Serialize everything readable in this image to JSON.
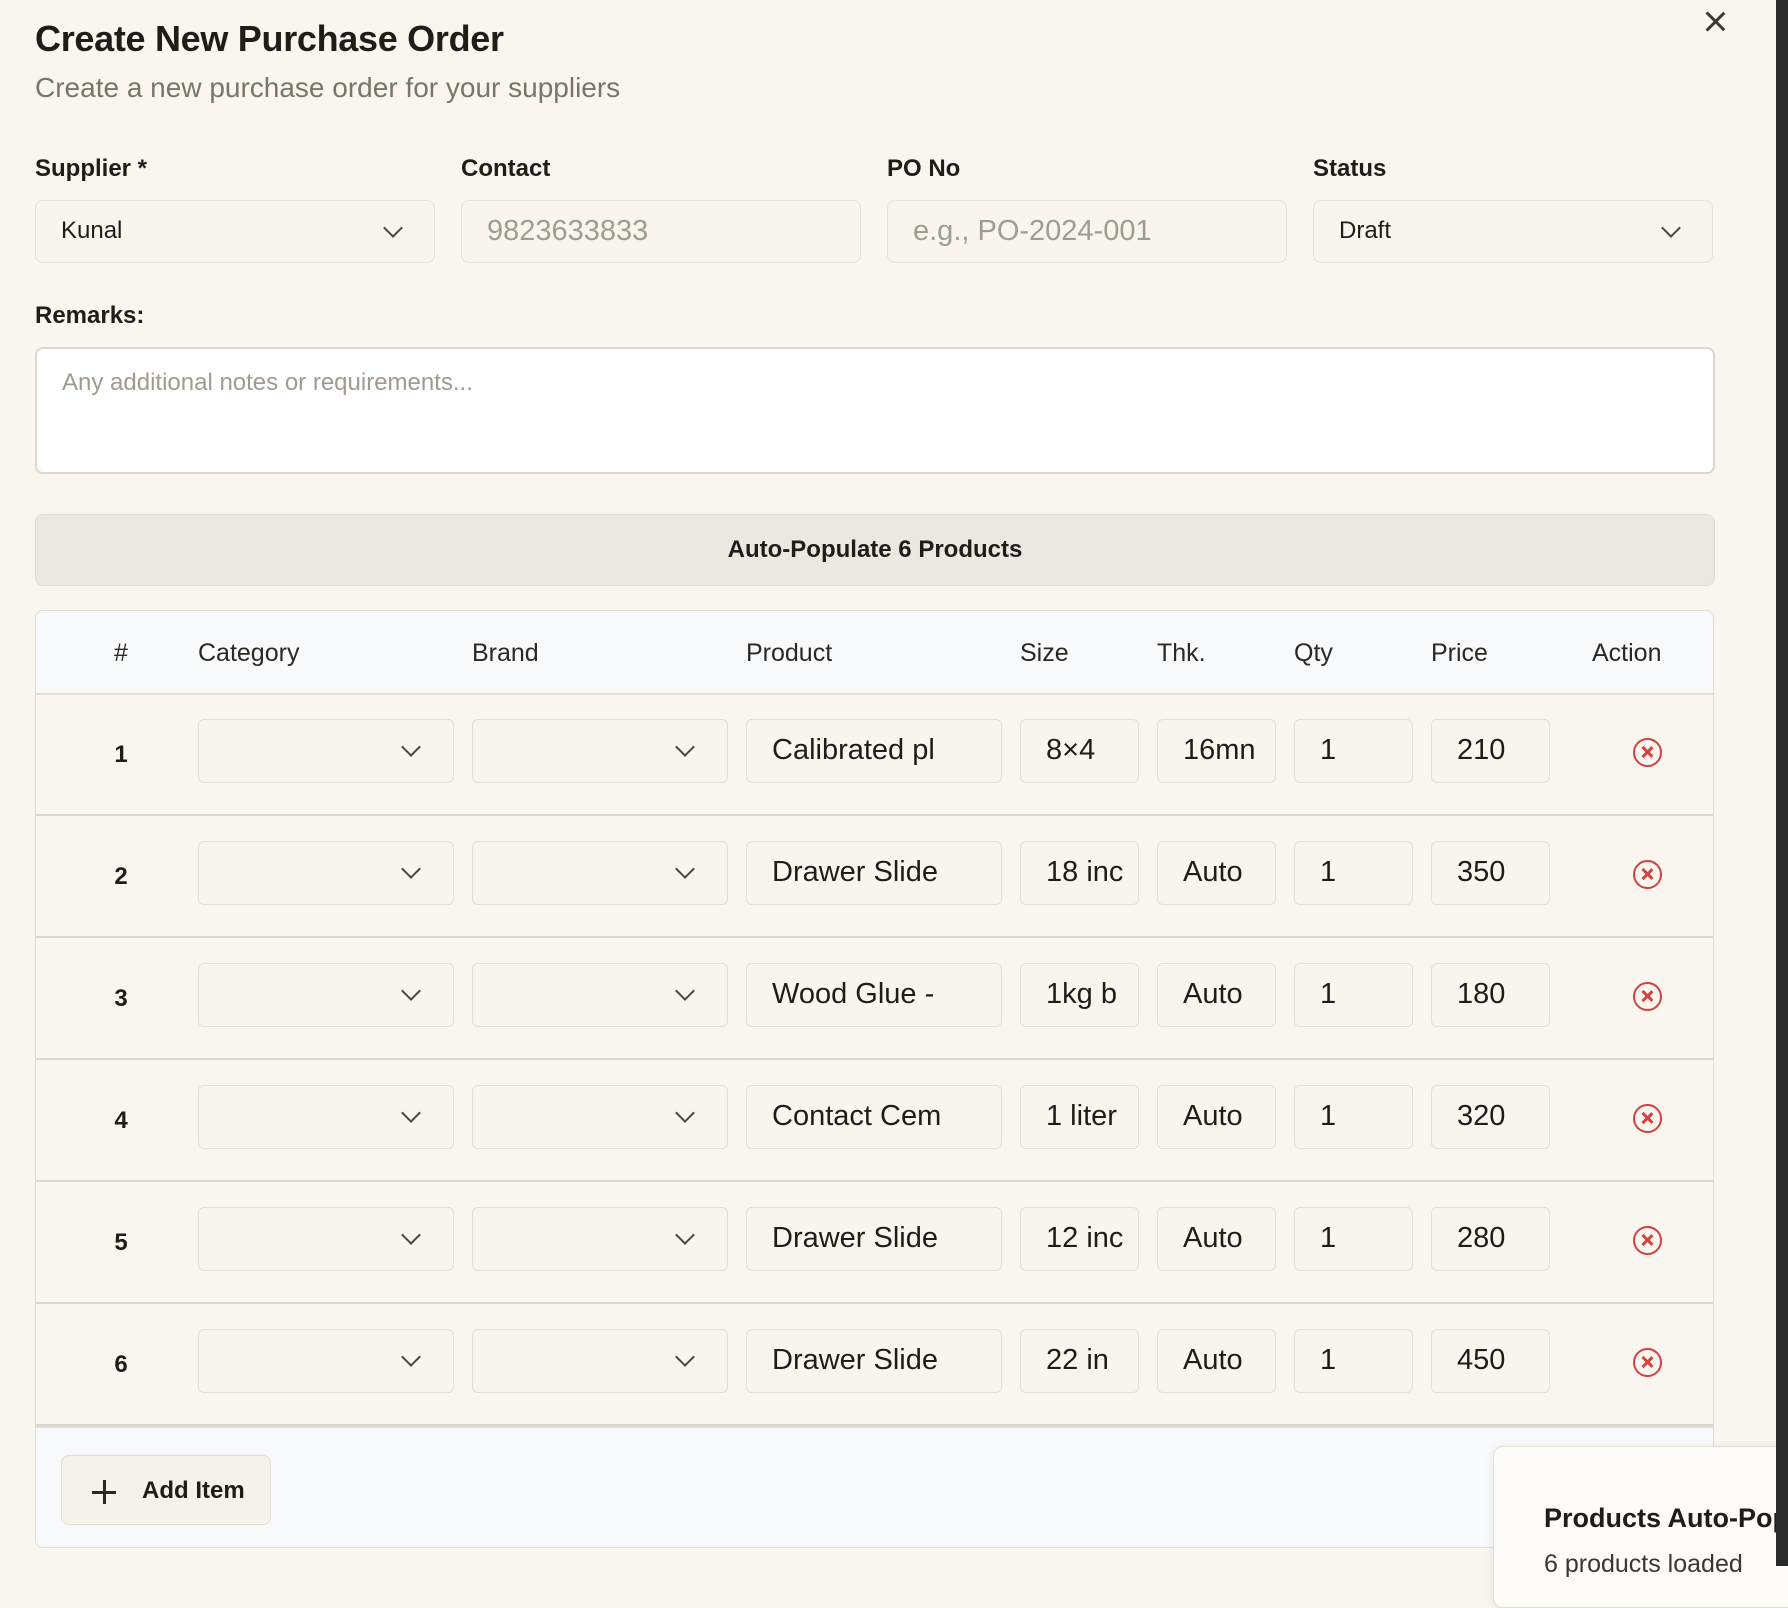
{
  "dialog": {
    "title": "Create New Purchase Order",
    "subtitle": "Create a new purchase order for your suppliers"
  },
  "form": {
    "supplier_label": "Supplier *",
    "supplier_value": "Kunal",
    "contact_label": "Contact",
    "contact_placeholder": "9823633833",
    "po_label": "PO No",
    "po_placeholder": "e.g., PO-2024-001",
    "status_label": "Status",
    "status_value": "Draft",
    "remarks_label": "Remarks:",
    "remarks_placeholder": "Any additional notes or requirements..."
  },
  "autopopulate_label": "Auto-Populate 6 Products",
  "table": {
    "headers": [
      "#",
      "Category",
      "Brand",
      "Product",
      "Size",
      "Thk.",
      "Qty",
      "Price",
      "Action"
    ],
    "rows": [
      {
        "num": "1",
        "product": "Calibrated pl",
        "size": "8×4",
        "thk": "16mn",
        "qty": "1",
        "price": "210"
      },
      {
        "num": "2",
        "product": "Drawer Slide",
        "size": "18 inc",
        "thk": "Auto",
        "qty": "1",
        "price": "350"
      },
      {
        "num": "3",
        "product": "Wood Glue -",
        "size": "1kg b",
        "thk": "Auto",
        "qty": "1",
        "price": "180"
      },
      {
        "num": "4",
        "product": "Contact Cem",
        "size": "1 liter",
        "thk": "Auto",
        "qty": "1",
        "price": "320"
      },
      {
        "num": "5",
        "product": "Drawer Slide",
        "size": "12 inc",
        "thk": "Auto",
        "qty": "1",
        "price": "280"
      },
      {
        "num": "6",
        "product": "Drawer Slide",
        "size": "22 in",
        "thk": "Auto",
        "qty": "1",
        "price": "450"
      }
    ],
    "add_item_label": "Add Item"
  },
  "toast": {
    "title": "Products Auto-Populated",
    "description": "6 products loaded"
  },
  "colors": {
    "background": "#f8f6ef",
    "danger": "#d64040",
    "header_bg": "#f8f9fb"
  }
}
